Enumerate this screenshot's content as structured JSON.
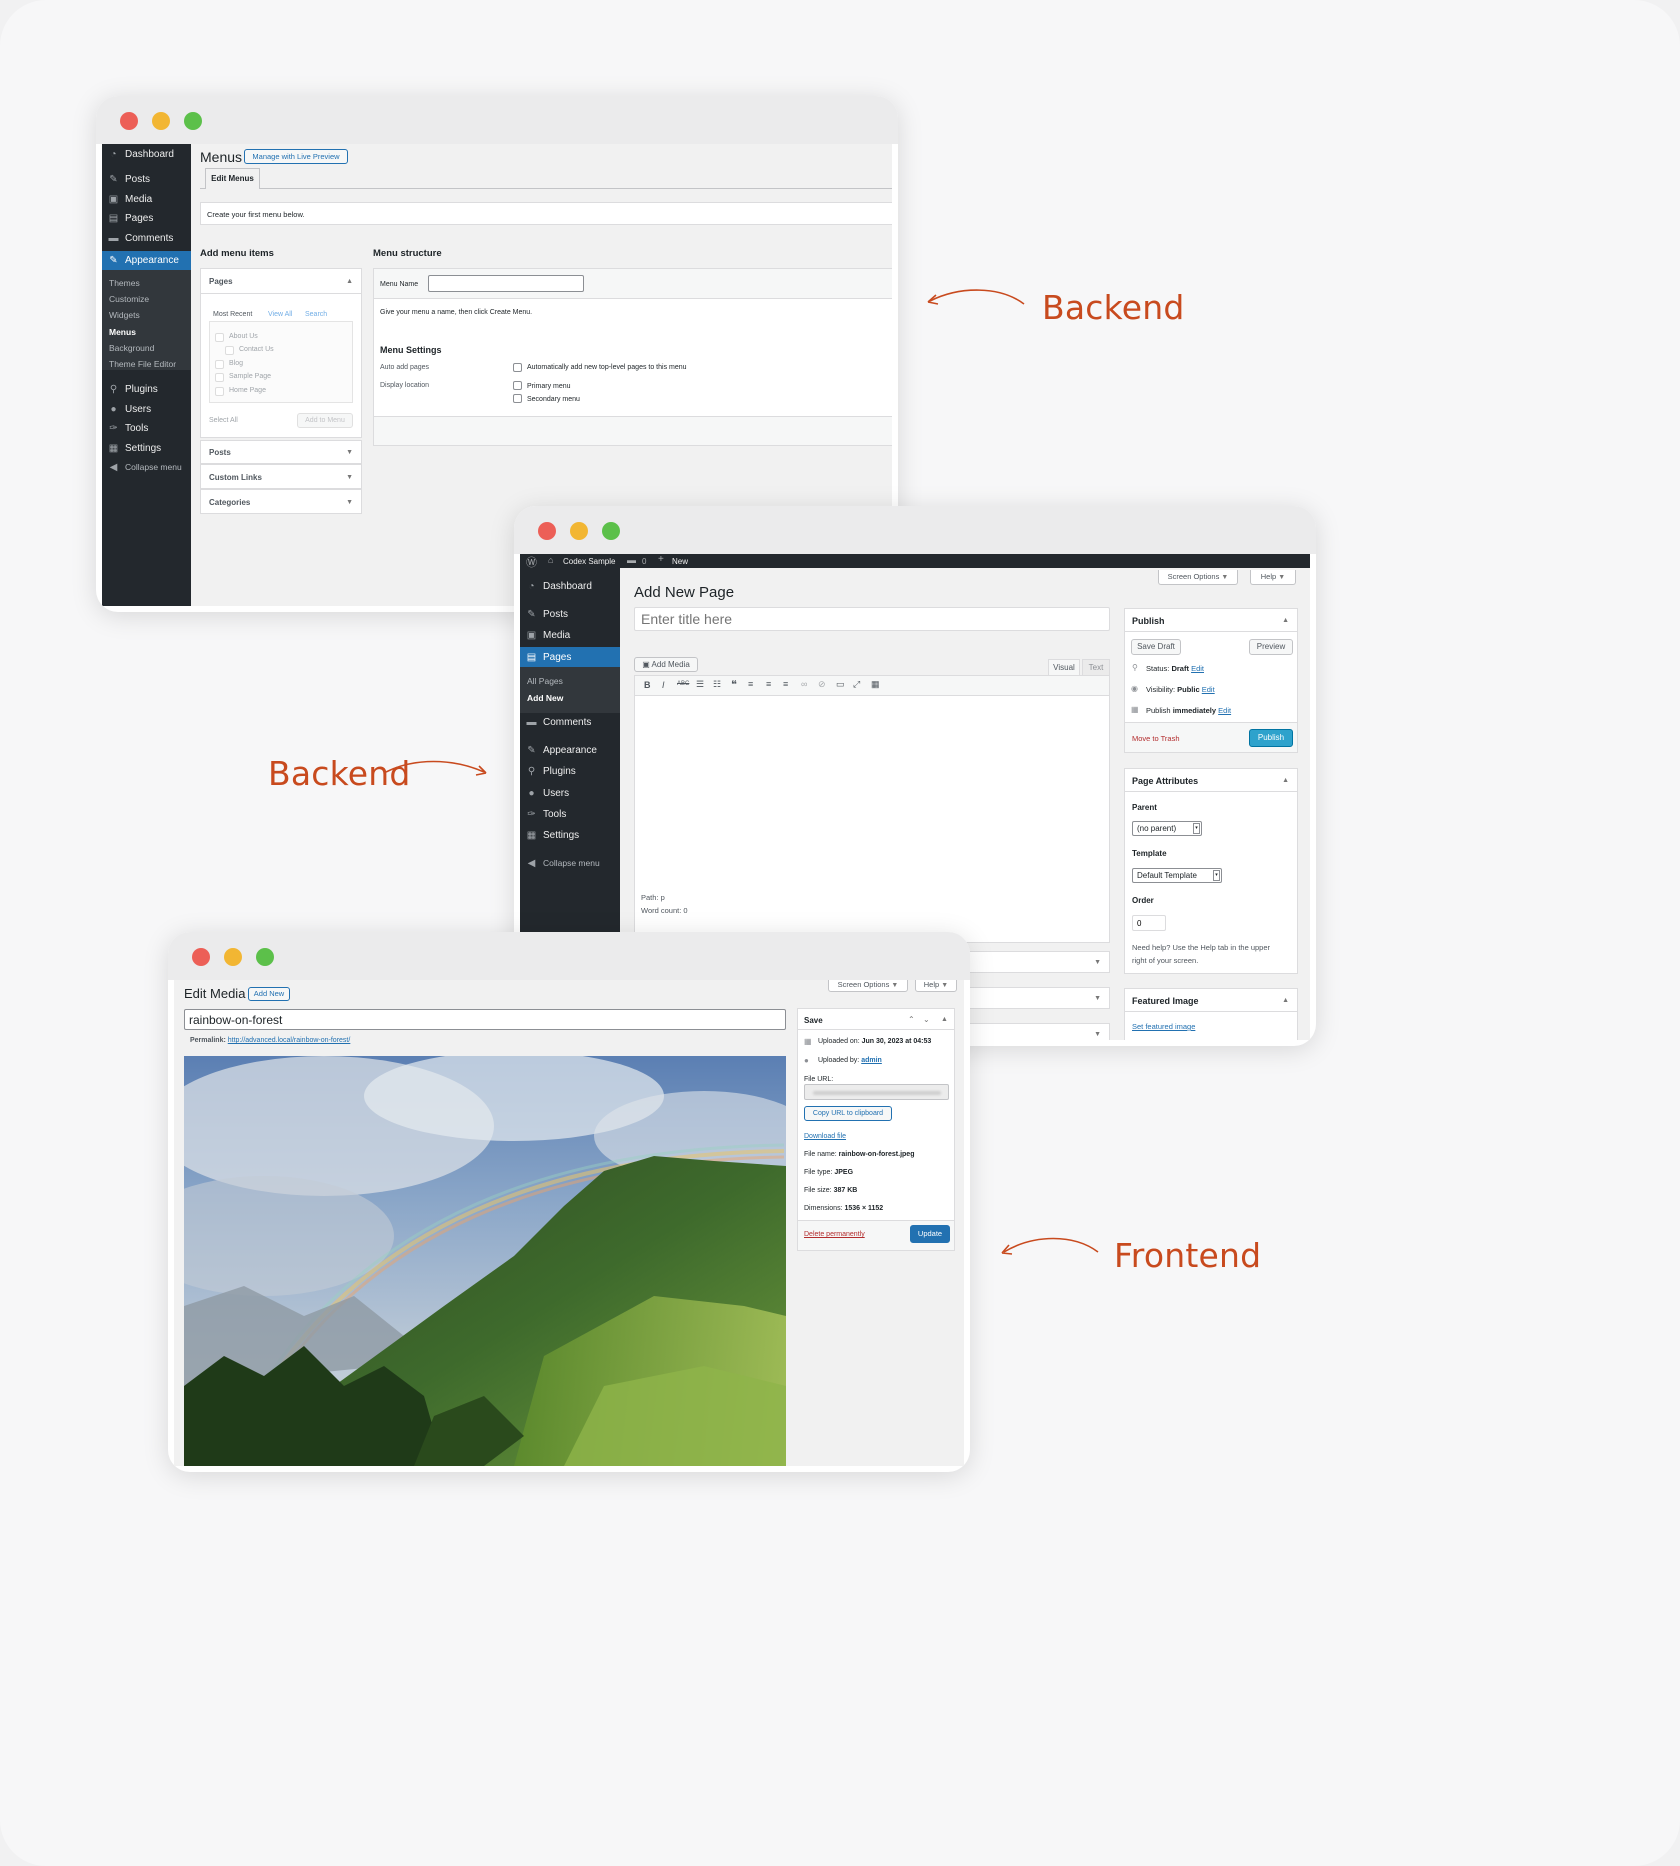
{
  "labels": {
    "backend_1": "Backend",
    "backend_2": "Backend",
    "frontend": "Frontend"
  },
  "colors": {
    "label": "#c84a1e",
    "wp_sidebar": "#23282d",
    "wp_blue": "#2271b1",
    "red_close": "#ec5f57",
    "yellow_min": "#f2b633",
    "green_max": "#5cc04a"
  },
  "menus": {
    "sidebar": [
      {
        "label": "Dashboard",
        "icon": "dashboard-icon"
      },
      {
        "label": "Posts",
        "icon": "pin-icon"
      },
      {
        "label": "Media",
        "icon": "media-icon"
      },
      {
        "label": "Pages",
        "icon": "pages-icon"
      },
      {
        "label": "Comments",
        "icon": "comment-icon"
      },
      {
        "label": "Appearance",
        "icon": "brush-icon"
      },
      {
        "label": "Plugins",
        "icon": "plug-icon"
      },
      {
        "label": "Users",
        "icon": "users-icon"
      },
      {
        "label": "Tools",
        "icon": "wrench-icon"
      },
      {
        "label": "Settings",
        "icon": "settings-icon"
      },
      {
        "label": "Collapse menu",
        "icon": "collapse-icon"
      }
    ],
    "submenu": [
      "Themes",
      "Customize",
      "Widgets",
      "Menus",
      "Background",
      "Theme File Editor"
    ],
    "title": "Menus",
    "live_preview": "Manage with Live Preview",
    "tab": "Edit Menus",
    "notice": "Create your first menu below.",
    "add_items_heading": "Add menu items",
    "pages_panel": "Pages",
    "subtabs": [
      "Most Recent",
      "View All",
      "Search"
    ],
    "pages": [
      "About Us",
      "Contact Us",
      "Blog",
      "Sample Page",
      "Home Page"
    ],
    "select_all": "Select All",
    "add_to_menu": "Add to Menu",
    "panels": [
      "Posts",
      "Custom Links",
      "Categories"
    ],
    "structure_heading": "Menu structure",
    "menu_name_label": "Menu Name",
    "menu_name_value": "",
    "hint": "Give your menu a name, then click Create Menu.",
    "settings_heading": "Menu Settings",
    "auto_add_label": "Auto add pages",
    "auto_add_text": "Automatically add new top-level pages to this menu",
    "display_location_label": "Display location",
    "locations": [
      "Primary menu",
      "Secondary menu"
    ]
  },
  "pages_win": {
    "adminbar": {
      "site": "Codex Sample",
      "comments": "0",
      "new": "New"
    },
    "sidebar": [
      {
        "label": "Dashboard",
        "icon": "dashboard-icon"
      },
      {
        "label": "Posts",
        "icon": "pin-icon"
      },
      {
        "label": "Media",
        "icon": "media-icon"
      },
      {
        "label": "Pages",
        "icon": "pages-icon"
      },
      {
        "label": "Comments",
        "icon": "comment-icon"
      },
      {
        "label": "Appearance",
        "icon": "brush-icon"
      },
      {
        "label": "Plugins",
        "icon": "plug-icon"
      },
      {
        "label": "Users",
        "icon": "users-icon"
      },
      {
        "label": "Tools",
        "icon": "wrench-icon"
      },
      {
        "label": "Settings",
        "icon": "settings-icon"
      },
      {
        "label": "Collapse menu",
        "icon": "collapse-icon"
      }
    ],
    "submenu": [
      "All Pages",
      "Add New"
    ],
    "screen_options": "Screen Options",
    "help": "Help",
    "title": "Add New Page",
    "title_placeholder": "Enter title here",
    "add_media": "Add Media",
    "tab_visual": "Visual",
    "tab_text": "Text",
    "path": "Path: p",
    "word_count": "Word count: 0",
    "publish": {
      "heading": "Publish",
      "save_draft": "Save Draft",
      "preview": "Preview",
      "status_label": "Status:",
      "status_value": "Draft",
      "visibility_label": "Visibility:",
      "visibility_value": "Public",
      "publish_label": "Publish",
      "publish_value": "immediately",
      "edit": "Edit",
      "trash": "Move to Trash",
      "button": "Publish"
    },
    "attributes": {
      "heading": "Page Attributes",
      "parent_label": "Parent",
      "parent_value": "(no parent)",
      "template_label": "Template",
      "template_value": "Default Template",
      "order_label": "Order",
      "order_value": "0",
      "help_text_1": "Need help? Use the Help tab in the upper",
      "help_text_2": "right of your screen."
    },
    "featured": {
      "heading": "Featured Image",
      "link": "Set featured image"
    }
  },
  "media_win": {
    "screen_options": "Screen Options",
    "help": "Help",
    "title": "Edit Media",
    "add_new": "Add New",
    "name_value": "rainbow-on-forest",
    "permalink_label": "Permalink:",
    "permalink_url": "http://advanced.local/rainbow-on-forest/",
    "save_heading": "Save",
    "uploaded_on_label": "Uploaded on:",
    "uploaded_on_value": "Jun 30, 2023 at 04:53",
    "uploaded_by_label": "Uploaded by:",
    "uploaded_by_value": "admin",
    "file_url_label": "File URL:",
    "copy_url": "Copy URL to clipboard",
    "download": "Download file",
    "file_name_label": "File name:",
    "file_name_value": "rainbow-on-forest.jpeg",
    "file_type_label": "File type:",
    "file_type_value": "JPEG",
    "file_size_label": "File size:",
    "file_size_value": "387 KB",
    "dimensions_label": "Dimensions:",
    "dimensions_value": "1536 × 1152",
    "delete": "Delete permanently",
    "update": "Update"
  }
}
